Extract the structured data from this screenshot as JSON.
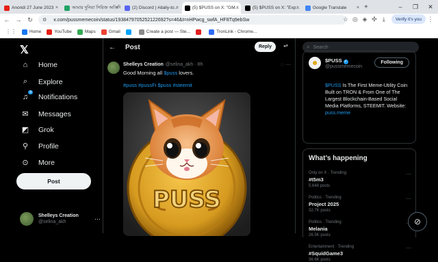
{
  "browser": {
    "tabs": [
      {
        "title": "Anondi 27 June 2023",
        "fav_color": "#e62117",
        "active": false
      },
      {
        "title": "আমার দুনিয়া সিরিজ অতিথি মো...",
        "fav_color": "#21a366",
        "active": false
      },
      {
        "title": "(2) Discord | #daily-to...",
        "fav_color": "#5865f2",
        "active": false
      },
      {
        "title": "(5) $PUSS on X: \"GM...",
        "fav_color": "#000000",
        "active": true
      },
      {
        "title": "(5) $PUSS on X: \"Exp...",
        "fav_color": "#000000",
        "active": false
      },
      {
        "title": "Google Translate",
        "fav_color": "#4285f4",
        "active": false
      }
    ],
    "url": "x.com/pussmemecoin/status/1938479705252122692?s=46&t=nHPwcg_swfA_HF8Tq9ebSw",
    "verify_label": "Verify it's you",
    "bookmarks": [
      {
        "label": "Home",
        "fav_color": "#1877f2"
      },
      {
        "label": "YouTube",
        "fav_color": "#e62117"
      },
      {
        "label": "Maps",
        "fav_color": "#34a853"
      },
      {
        "label": "Gmail",
        "fav_color": "#ea4335"
      },
      {
        "label": "",
        "fav_color": "#00a2ff"
      },
      {
        "label": "Create a post — Ste...",
        "fav_color": "#8a8a8a"
      },
      {
        "label": "",
        "fav_color": "#e02020"
      },
      {
        "label": "TronLink - Chrome...",
        "fav_color": "#2f6cf6"
      }
    ]
  },
  "x": {
    "nav": [
      {
        "label": "Home",
        "icon": "home-icon",
        "glyph": "⌂"
      },
      {
        "label": "Explore",
        "icon": "search-icon",
        "glyph": "⌕"
      },
      {
        "label": "Notifications",
        "icon": "bell-icon",
        "glyph": "🔔",
        "badge": "9"
      },
      {
        "label": "Messages",
        "icon": "mail-icon",
        "glyph": "✉"
      },
      {
        "label": "Grok",
        "icon": "grok-icon",
        "glyph": "◩"
      },
      {
        "label": "Profile",
        "icon": "person-icon",
        "glyph": "👤"
      },
      {
        "label": "More",
        "icon": "more-icon",
        "glyph": "⋯"
      }
    ],
    "post_button": "Post",
    "account": {
      "name": "Shelleys Creation",
      "handle": "@selina_akh"
    },
    "main": {
      "title": "Post",
      "reply_label": "Reply",
      "tweet": {
        "name": "Shelleys Creation",
        "handle": "@selina_akh · 8h",
        "text_before": "Good Morning all ",
        "text_link": "$puss",
        "text_after": " lovers.",
        "tags": "#puss #pussFi $puss #steemit",
        "media_caption": "PUSS"
      }
    },
    "right": {
      "search_placeholder": "Search",
      "profile": {
        "name": "$PUSS",
        "handle": "@pussmemecoin",
        "follow_label": "Following",
        "bio_link": "$PUSS",
        "bio_text": " Is The First Meme-Utility Coin Built on TRON & From One of The Largest Blockchain-Based Social Media Platforms, STEEMIT. Website: ",
        "bio_site": "puss.meme"
      },
      "whats_happening": "What’s happening",
      "trends": [
        {
          "category": "Only on X · Trending",
          "name": "#t5m3",
          "count": "5,648 posts"
        },
        {
          "category": "Politics · Trending",
          "name": "Project 2025",
          "count": "32.7K posts"
        },
        {
          "category": "Politics · Trending",
          "name": "Melania",
          "count": "26.5K posts"
        },
        {
          "category": "Entertainment · Trending",
          "name": "#SquidGame3",
          "count": "36.6K posts"
        }
      ]
    }
  },
  "colors": {
    "accent": "#1d9bf0",
    "background": "#000000",
    "text": "#e7e9ea",
    "muted": "#71767b"
  }
}
